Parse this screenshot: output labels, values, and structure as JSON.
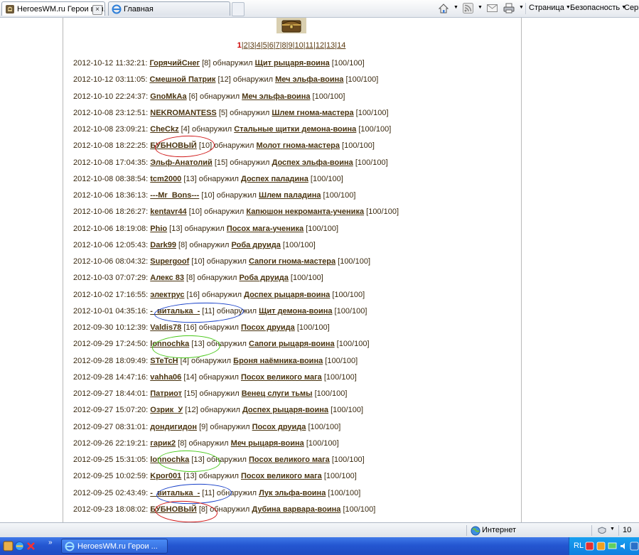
{
  "browser": {
    "tabs": [
      {
        "label": "HeroesWM.ru Герои вой...",
        "active": true
      },
      {
        "label": "Главная",
        "active": false
      }
    ],
    "commands": [
      {
        "label": "Страница"
      },
      {
        "label": "Безопасность"
      },
      {
        "label": "Серв"
      }
    ]
  },
  "pagination": {
    "current": "1",
    "pages": [
      "1",
      "2",
      "3",
      "4",
      "5",
      "6",
      "7",
      "8",
      "9",
      "10",
      "11",
      "12",
      "13",
      "14"
    ]
  },
  "log": [
    {
      "ts": "2012-10-12 11:32:21:",
      "player": "ГорячийСнег",
      "level": "[8]",
      "action": "обнаружил",
      "item": "Щит рыцаря-воина",
      "durability": "[100/100]"
    },
    {
      "ts": "2012-10-12 03:11:05:",
      "player": "Смешной Патрик",
      "level": "[12]",
      "action": "обнаружил",
      "item": "Меч эльфа-воина",
      "durability": "[100/100]"
    },
    {
      "ts": "2012-10-10 22:24:37:",
      "player": "GnoMkAa",
      "level": "[6]",
      "action": "обнаружил",
      "item": "Меч эльфа-воина",
      "durability": "[100/100]"
    },
    {
      "ts": "2012-10-08 23:12:51:",
      "player": "NEKROMANTESS",
      "level": "[5]",
      "action": "обнаружил",
      "item": "Шлем гнома-мастера",
      "durability": "[100/100]"
    },
    {
      "ts": "2012-10-08 23:09:21:",
      "player": "CheCkz",
      "level": "[4]",
      "action": "обнаружил",
      "item": "Стальные щитки демона-воина",
      "durability": "[100/100]"
    },
    {
      "ts": "2012-10-08 18:22:25:",
      "player": "БУБНОВЫЙ",
      "level": "[10]",
      "action": "обнаружил",
      "item": "Молот гнома-мастера",
      "durability": "[100/100]"
    },
    {
      "ts": "2012-10-08 17:04:35:",
      "player": "Эльф-Анатолий",
      "level": "[15]",
      "action": "обнаружил",
      "item": "Доспех эльфа-воина",
      "durability": "[100/100]"
    },
    {
      "ts": "2012-10-08 08:38:54:",
      "player": "tcm2000",
      "level": "[13]",
      "action": "обнаружил",
      "item": "Доспех паладина",
      "durability": "[100/100]"
    },
    {
      "ts": "2012-10-06 18:36:13:",
      "player": "---Mr_Bons---",
      "level": "[10]",
      "action": "обнаружил",
      "item": "Шлем паладина",
      "durability": "[100/100]"
    },
    {
      "ts": "2012-10-06 18:26:27:",
      "player": "kentavr44",
      "level": "[10]",
      "action": "обнаружил",
      "item": "Капюшон некроманта-ученика",
      "durability": "[100/100]"
    },
    {
      "ts": "2012-10-06 18:19:08:",
      "player": "Phio",
      "level": "[13]",
      "action": "обнаружил",
      "item": "Посох мага-ученика",
      "durability": "[100/100]"
    },
    {
      "ts": "2012-10-06 12:05:43:",
      "player": "Dark99",
      "level": "[8]",
      "action": "обнаружил",
      "item": "Роба друида",
      "durability": "[100/100]"
    },
    {
      "ts": "2012-10-06 08:04:32:",
      "player": "Supergoof",
      "level": "[10]",
      "action": "обнаружил",
      "item": "Сапоги гнома-мастера",
      "durability": "[100/100]"
    },
    {
      "ts": "2012-10-03 07:07:29:",
      "player": "Алекс 83",
      "level": "[8]",
      "action": "обнаружил",
      "item": "Роба друида",
      "durability": "[100/100]"
    },
    {
      "ts": "2012-10-02 17:16:55:",
      "player": "электрус",
      "level": "[16]",
      "action": "обнаружил",
      "item": "Доспех рыцаря-воина",
      "durability": "[100/100]"
    },
    {
      "ts": "2012-10-01 04:35:16:",
      "player": "-_виталька_-",
      "level": "[11]",
      "action": "обнаружил",
      "item": "Щит демона-воина",
      "durability": "[100/100]"
    },
    {
      "ts": "2012-09-30 10:12:39:",
      "player": "Valdis78",
      "level": "[16]",
      "action": "обнаружил",
      "item": "Посох друида",
      "durability": "[100/100]"
    },
    {
      "ts": "2012-09-29 17:24:50:",
      "player": "lonnochka",
      "level": "[13]",
      "action": "обнаружил",
      "item": "Сапоги рыцаря-воина",
      "durability": "[100/100]"
    },
    {
      "ts": "2012-09-28 18:09:49:",
      "player": "STeTcH",
      "level": "[4]",
      "action": "обнаружил",
      "item": "Броня наёмника-воина",
      "durability": "[100/100]"
    },
    {
      "ts": "2012-09-28 14:47:16:",
      "player": "vahha06",
      "level": "[14]",
      "action": "обнаружил",
      "item": "Посох великого мага",
      "durability": "[100/100]"
    },
    {
      "ts": "2012-09-27 18:44:01:",
      "player": "Патриот",
      "level": "[15]",
      "action": "обнаружил",
      "item": "Венец слуги тьмы",
      "durability": "[100/100]"
    },
    {
      "ts": "2012-09-27 15:07:20:",
      "player": "Озрик_У",
      "level": "[12]",
      "action": "обнаружил",
      "item": "Доспех рыцаря-воина",
      "durability": "[100/100]"
    },
    {
      "ts": "2012-09-27 08:31:01:",
      "player": "дондигидон",
      "level": "[9]",
      "action": "обнаружил",
      "item": "Посох друида",
      "durability": "[100/100]"
    },
    {
      "ts": "2012-09-26 22:19:21:",
      "player": "гарик2",
      "level": "[8]",
      "action": "обнаружил",
      "item": "Меч рыцаря-воина",
      "durability": "[100/100]"
    },
    {
      "ts": "2012-09-25 15:31:05:",
      "player": "lonnochka",
      "level": "[13]",
      "action": "обнаружил",
      "item": "Посох великого мага",
      "durability": "[100/100]"
    },
    {
      "ts": "2012-09-25 10:02:59:",
      "player": "Kpor001",
      "level": "[13]",
      "action": "обнаружил",
      "item": "Посох великого мага",
      "durability": "[100/100]"
    },
    {
      "ts": "2012-09-25 02:43:49:",
      "player": "-_виталька_-",
      "level": "[11]",
      "action": "обнаружил",
      "item": "Лук эльфа-воина",
      "durability": "[100/100]"
    },
    {
      "ts": "2012-09-23 18:08:02:",
      "player": "БУБНОВЫЙ",
      "level": "[8]",
      "action": "обнаружил",
      "item": "Дубина варвара-воина",
      "durability": "[100/100]"
    }
  ],
  "annotations": {
    "red": "#d01818",
    "blue": "#1840c8",
    "green": "#48c818"
  },
  "statusbar": {
    "zone": "Интернет",
    "zoom": "10"
  },
  "taskbar": {
    "task_label": "HeroesWM.ru Герои ...",
    "lang": "RL"
  },
  "colors": {
    "link": "#4a3410",
    "current_page": "#cc0000",
    "taskbar": "#2456d1"
  }
}
